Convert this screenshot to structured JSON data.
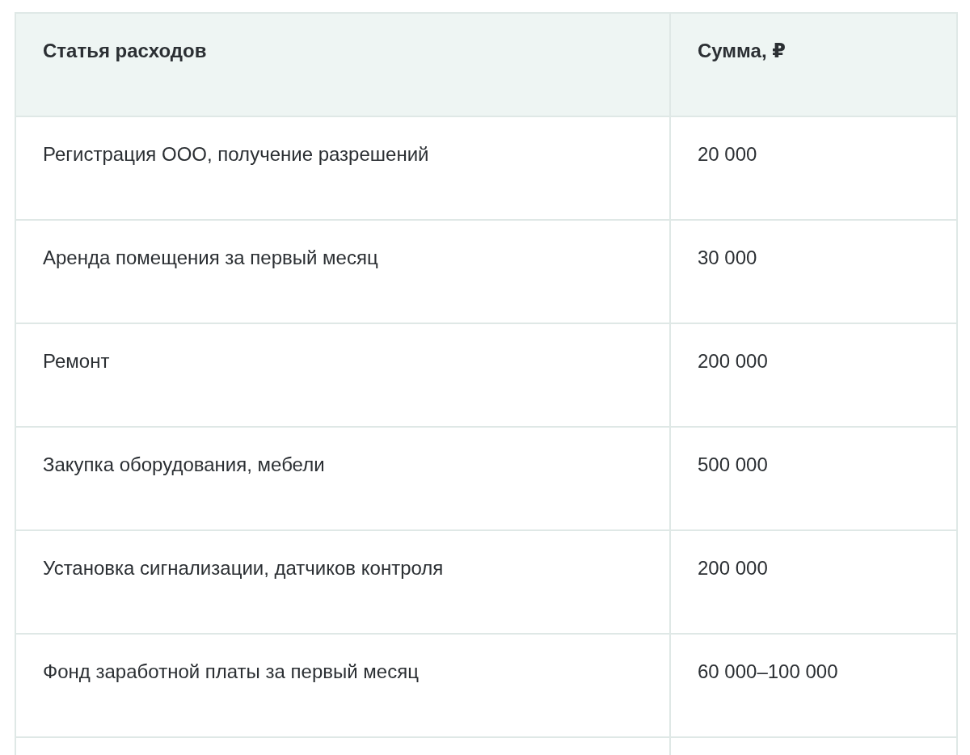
{
  "table": {
    "columns": [
      "Статья расходов",
      "Сумма, ₽"
    ],
    "rows": [
      {
        "item": "Регистрация ООО, получение разрешений",
        "amount": "20 000"
      },
      {
        "item": "Аренда помещения за первый месяц",
        "amount": "30 000"
      },
      {
        "item": "Ремонт",
        "amount": "200 000"
      },
      {
        "item": "Закупка оборудования, мебели",
        "amount": "500 000"
      },
      {
        "item": "Установка сигнализации, датчиков контроля",
        "amount": "200 000"
      },
      {
        "item": "Фонд заработной платы за первый месяц",
        "amount": "60 000–100 000"
      }
    ]
  }
}
